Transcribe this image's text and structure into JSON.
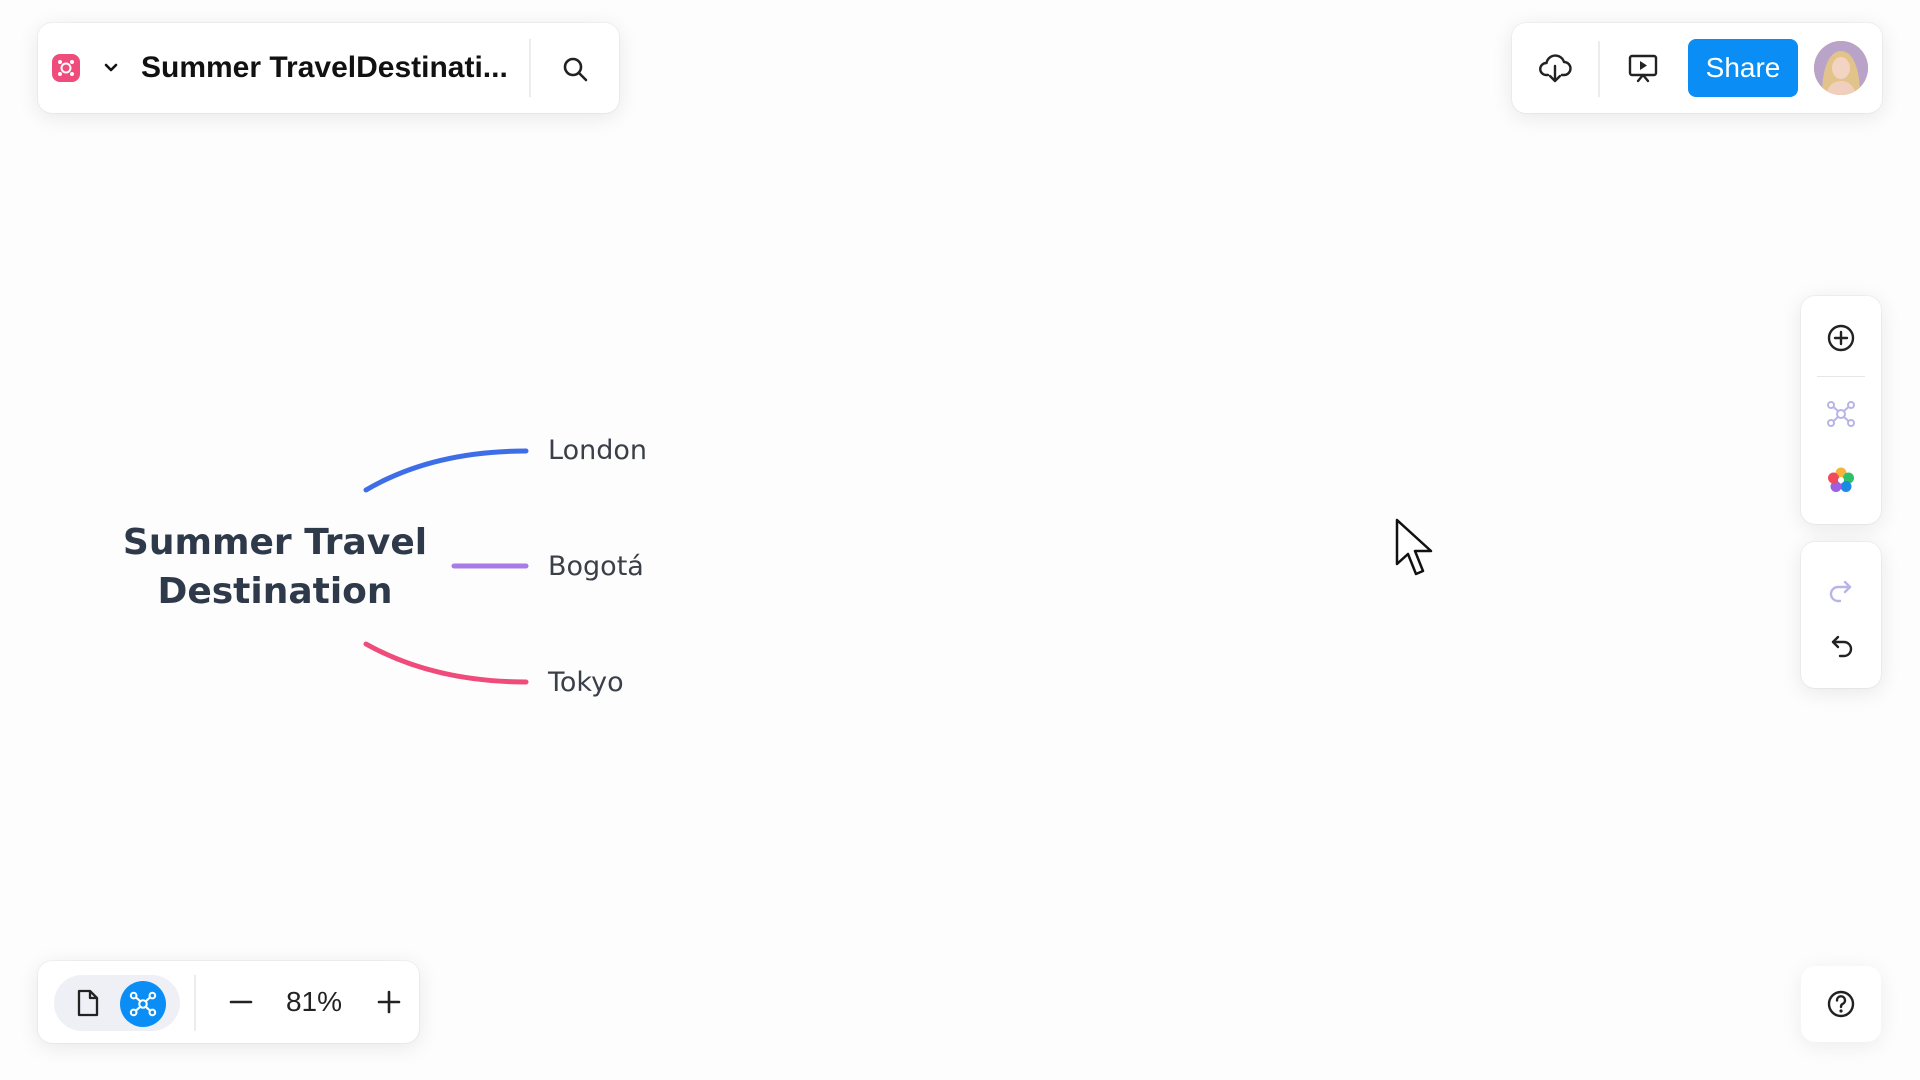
{
  "document": {
    "title": "Summer TravelDestinati..."
  },
  "toolbar": {
    "share_label": "Share"
  },
  "zoom": {
    "level": "81%"
  },
  "mindmap": {
    "central_topic_line1": "Summer Travel",
    "central_topic_line2": "Destination",
    "branches": [
      {
        "label": "London",
        "color": "#3d6ee8"
      },
      {
        "label": "Bogotá",
        "color": "#a77be8"
      },
      {
        "label": "Tokyo",
        "color": "#ef4b7b"
      }
    ]
  },
  "colors": {
    "accent": "#0a8ef5",
    "brand": "#ef4b7b"
  },
  "icons": {
    "app": "mindmap-logo-icon",
    "search": "search-icon",
    "download": "cloud-download-icon",
    "present": "present-icon",
    "add": "add-circle-icon",
    "structure": "mindmap-structure-icon",
    "theme": "color-palette-icon",
    "redo": "redo-icon",
    "undo": "undo-icon",
    "help": "help-icon"
  }
}
